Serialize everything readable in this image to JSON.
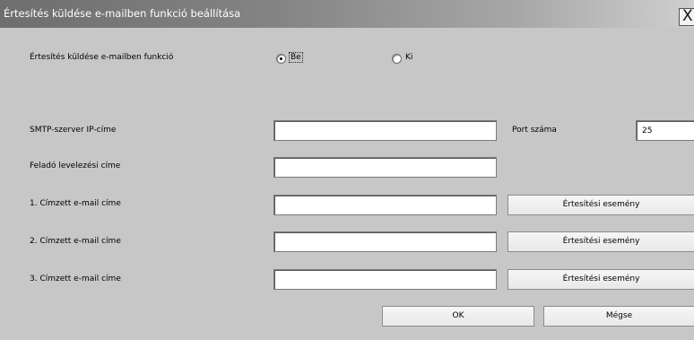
{
  "window": {
    "title": "Értesítés küldése e-mailben funkció beállítása",
    "close_glyph": "X"
  },
  "notification": {
    "label": "Értesítés küldése e-mailben funkció",
    "on_label": "Be",
    "off_label": "Ki",
    "selected": "Be"
  },
  "smtp": {
    "label": "SMTP-szerver IP-címe",
    "value": ""
  },
  "port": {
    "label": "Port száma",
    "value": "25"
  },
  "sender": {
    "label": "Feladó levelezési címe",
    "value": ""
  },
  "recipients": [
    {
      "label": "1. Címzett e-mail címe",
      "value": "",
      "button_label": "Értesítési esemény"
    },
    {
      "label": "2. Címzett e-mail címe",
      "value": "",
      "button_label": "Értesítési esemény"
    },
    {
      "label": "3. Címzett e-mail címe",
      "value": "",
      "button_label": "Értesítési esemény"
    }
  ],
  "buttons": {
    "ok_label": "OK",
    "cancel_label": "Mégse"
  },
  "colors": {
    "dialog_background": "#c7c7c7",
    "titlebar_text": "#ffffff"
  }
}
